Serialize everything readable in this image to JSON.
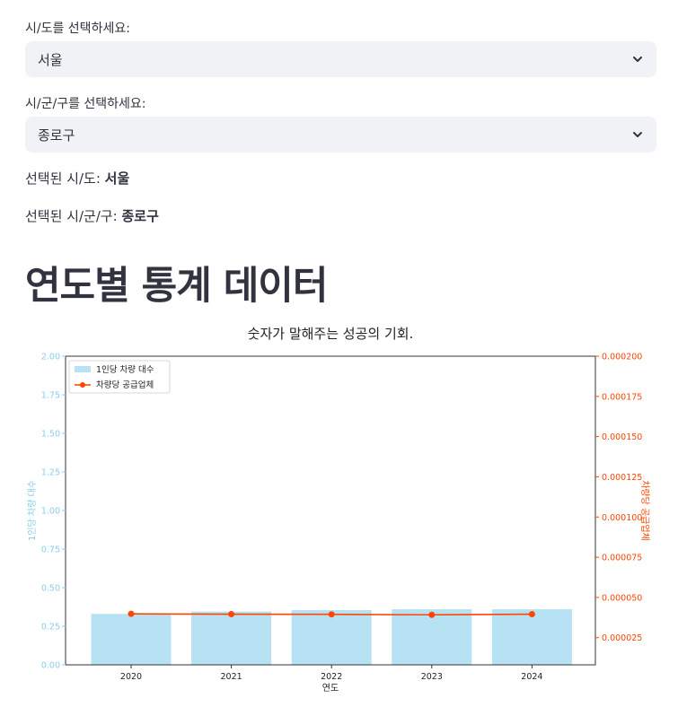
{
  "form": {
    "sido_label": "시/도를 선택하세요:",
    "sido_value": "서울",
    "sigungu_label": "시/군/구를 선택하세요:",
    "sigungu_value": "종로구",
    "selected_sido_prefix": "선택된 시/도: ",
    "selected_sido_value": "서울",
    "selected_sigungu_prefix": "선택된 시/군/구: ",
    "selected_sigungu_value": "종로구"
  },
  "heading": "연도별 통계 데이터",
  "chart_data": {
    "type": "bar",
    "title": "숫자가 말해주는 성공의 기회.",
    "xlabel": "연도",
    "categories": [
      "2020",
      "2021",
      "2022",
      "2023",
      "2024"
    ],
    "series": [
      {
        "name": "1인당 차량 대수",
        "type": "bar",
        "axis": "left",
        "color": "#87ceeb",
        "values": [
          0.33,
          0.345,
          0.355,
          0.36,
          0.36
        ]
      },
      {
        "name": "차량당 공급업체",
        "type": "line",
        "axis": "right",
        "color": "#ff4500",
        "values": [
          3.98e-05,
          3.96e-05,
          3.95e-05,
          3.92e-05,
          3.96e-05
        ]
      }
    ],
    "y_left": {
      "label": "1인당 차량 대수",
      "lim": [
        0,
        2.0
      ],
      "ticks": [
        "0.00",
        "0.25",
        "0.50",
        "0.75",
        "1.00",
        "1.25",
        "1.50",
        "1.75",
        "2.00"
      ],
      "color": "#87ceeb"
    },
    "y_right": {
      "label": "차량당 공급업체",
      "lim": [
        8.1e-06,
        0.0002
      ],
      "ticks": [
        "0.000025",
        "0.000050",
        "0.000075",
        "0.000100",
        "0.000125",
        "0.000150",
        "0.000175",
        "0.000200"
      ],
      "color": "#ff4500"
    },
    "legend": "top-left",
    "grid": false
  }
}
